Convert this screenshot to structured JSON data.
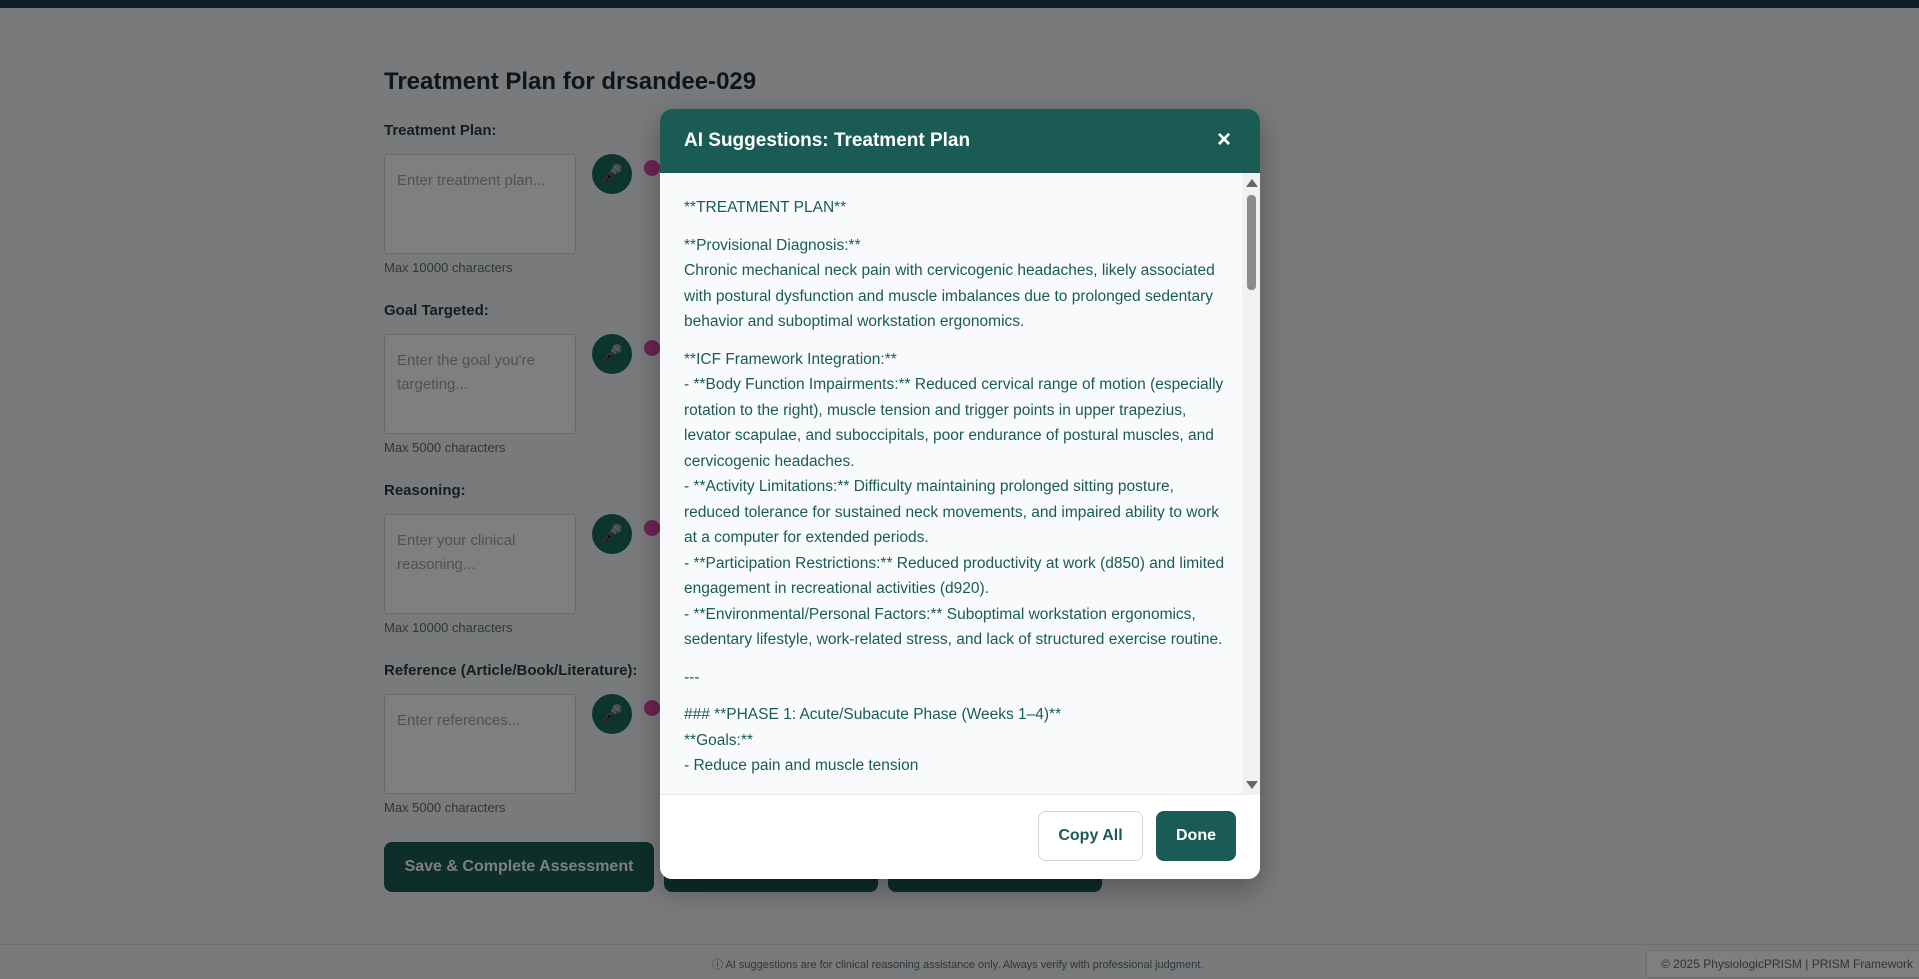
{
  "page": {
    "title": "Treatment Plan for drsandee-029",
    "fields": [
      {
        "label": "Treatment Plan:",
        "placeholder": "Enter treatment plan...",
        "hint": "Max 10000 characters"
      },
      {
        "label": "Goal Targeted:",
        "placeholder": "Enter the goal you're targeting...",
        "hint": "Max 5000 characters"
      },
      {
        "label": "Reasoning:",
        "placeholder": "Enter your clinical reasoning...",
        "hint": "Max 10000 characters"
      },
      {
        "label": "Reference (Article/Book/Literature):",
        "placeholder": "Enter references...",
        "hint": "Max 5000 characters"
      }
    ],
    "save_button": "Save & Complete Assessment"
  },
  "footer": {
    "note": "AI suggestions are for clinical reasoning assistance only. Always verify with professional judgment.",
    "copyright": "© 2025 PhysiologicPRISM | PRISM Framework"
  },
  "modal": {
    "title": "AI Suggestions: Treatment Plan",
    "close_icon": "×",
    "content": {
      "heading": "**TREATMENT PLAN**",
      "diag_label": "**Provisional Diagnosis:**",
      "diag_text": "Chronic mechanical neck pain with cervicogenic headaches, likely associated with postural dysfunction and muscle imbalances due to prolonged sedentary behavior and suboptimal workstation ergonomics.",
      "icf_label": "**ICF Framework Integration:**",
      "icf_items": [
        "- **Body Function Impairments:** Reduced cervical range of motion (especially rotation to the right), muscle tension and trigger points in upper trapezius, levator scapulae, and suboccipitals, poor endurance of postural muscles, and cervicogenic headaches.",
        "- **Activity Limitations:** Difficulty maintaining prolonged sitting posture, reduced tolerance for sustained neck movements, and impaired ability to work at a computer for extended periods.",
        "- **Participation Restrictions:** Reduced productivity at work (d850) and limited engagement in recreational activities (d920).",
        "- **Environmental/Personal Factors:** Suboptimal workstation ergonomics, sedentary lifestyle, work-related stress, and lack of structured exercise routine."
      ],
      "divider": "---",
      "phase1": "### **PHASE 1: Acute/Subacute Phase (Weeks 1–4)**",
      "goals_label": "**Goals:**",
      "goal1": "- Reduce pain and muscle tension"
    },
    "copy_button": "Copy All",
    "done_button": "Done"
  }
}
